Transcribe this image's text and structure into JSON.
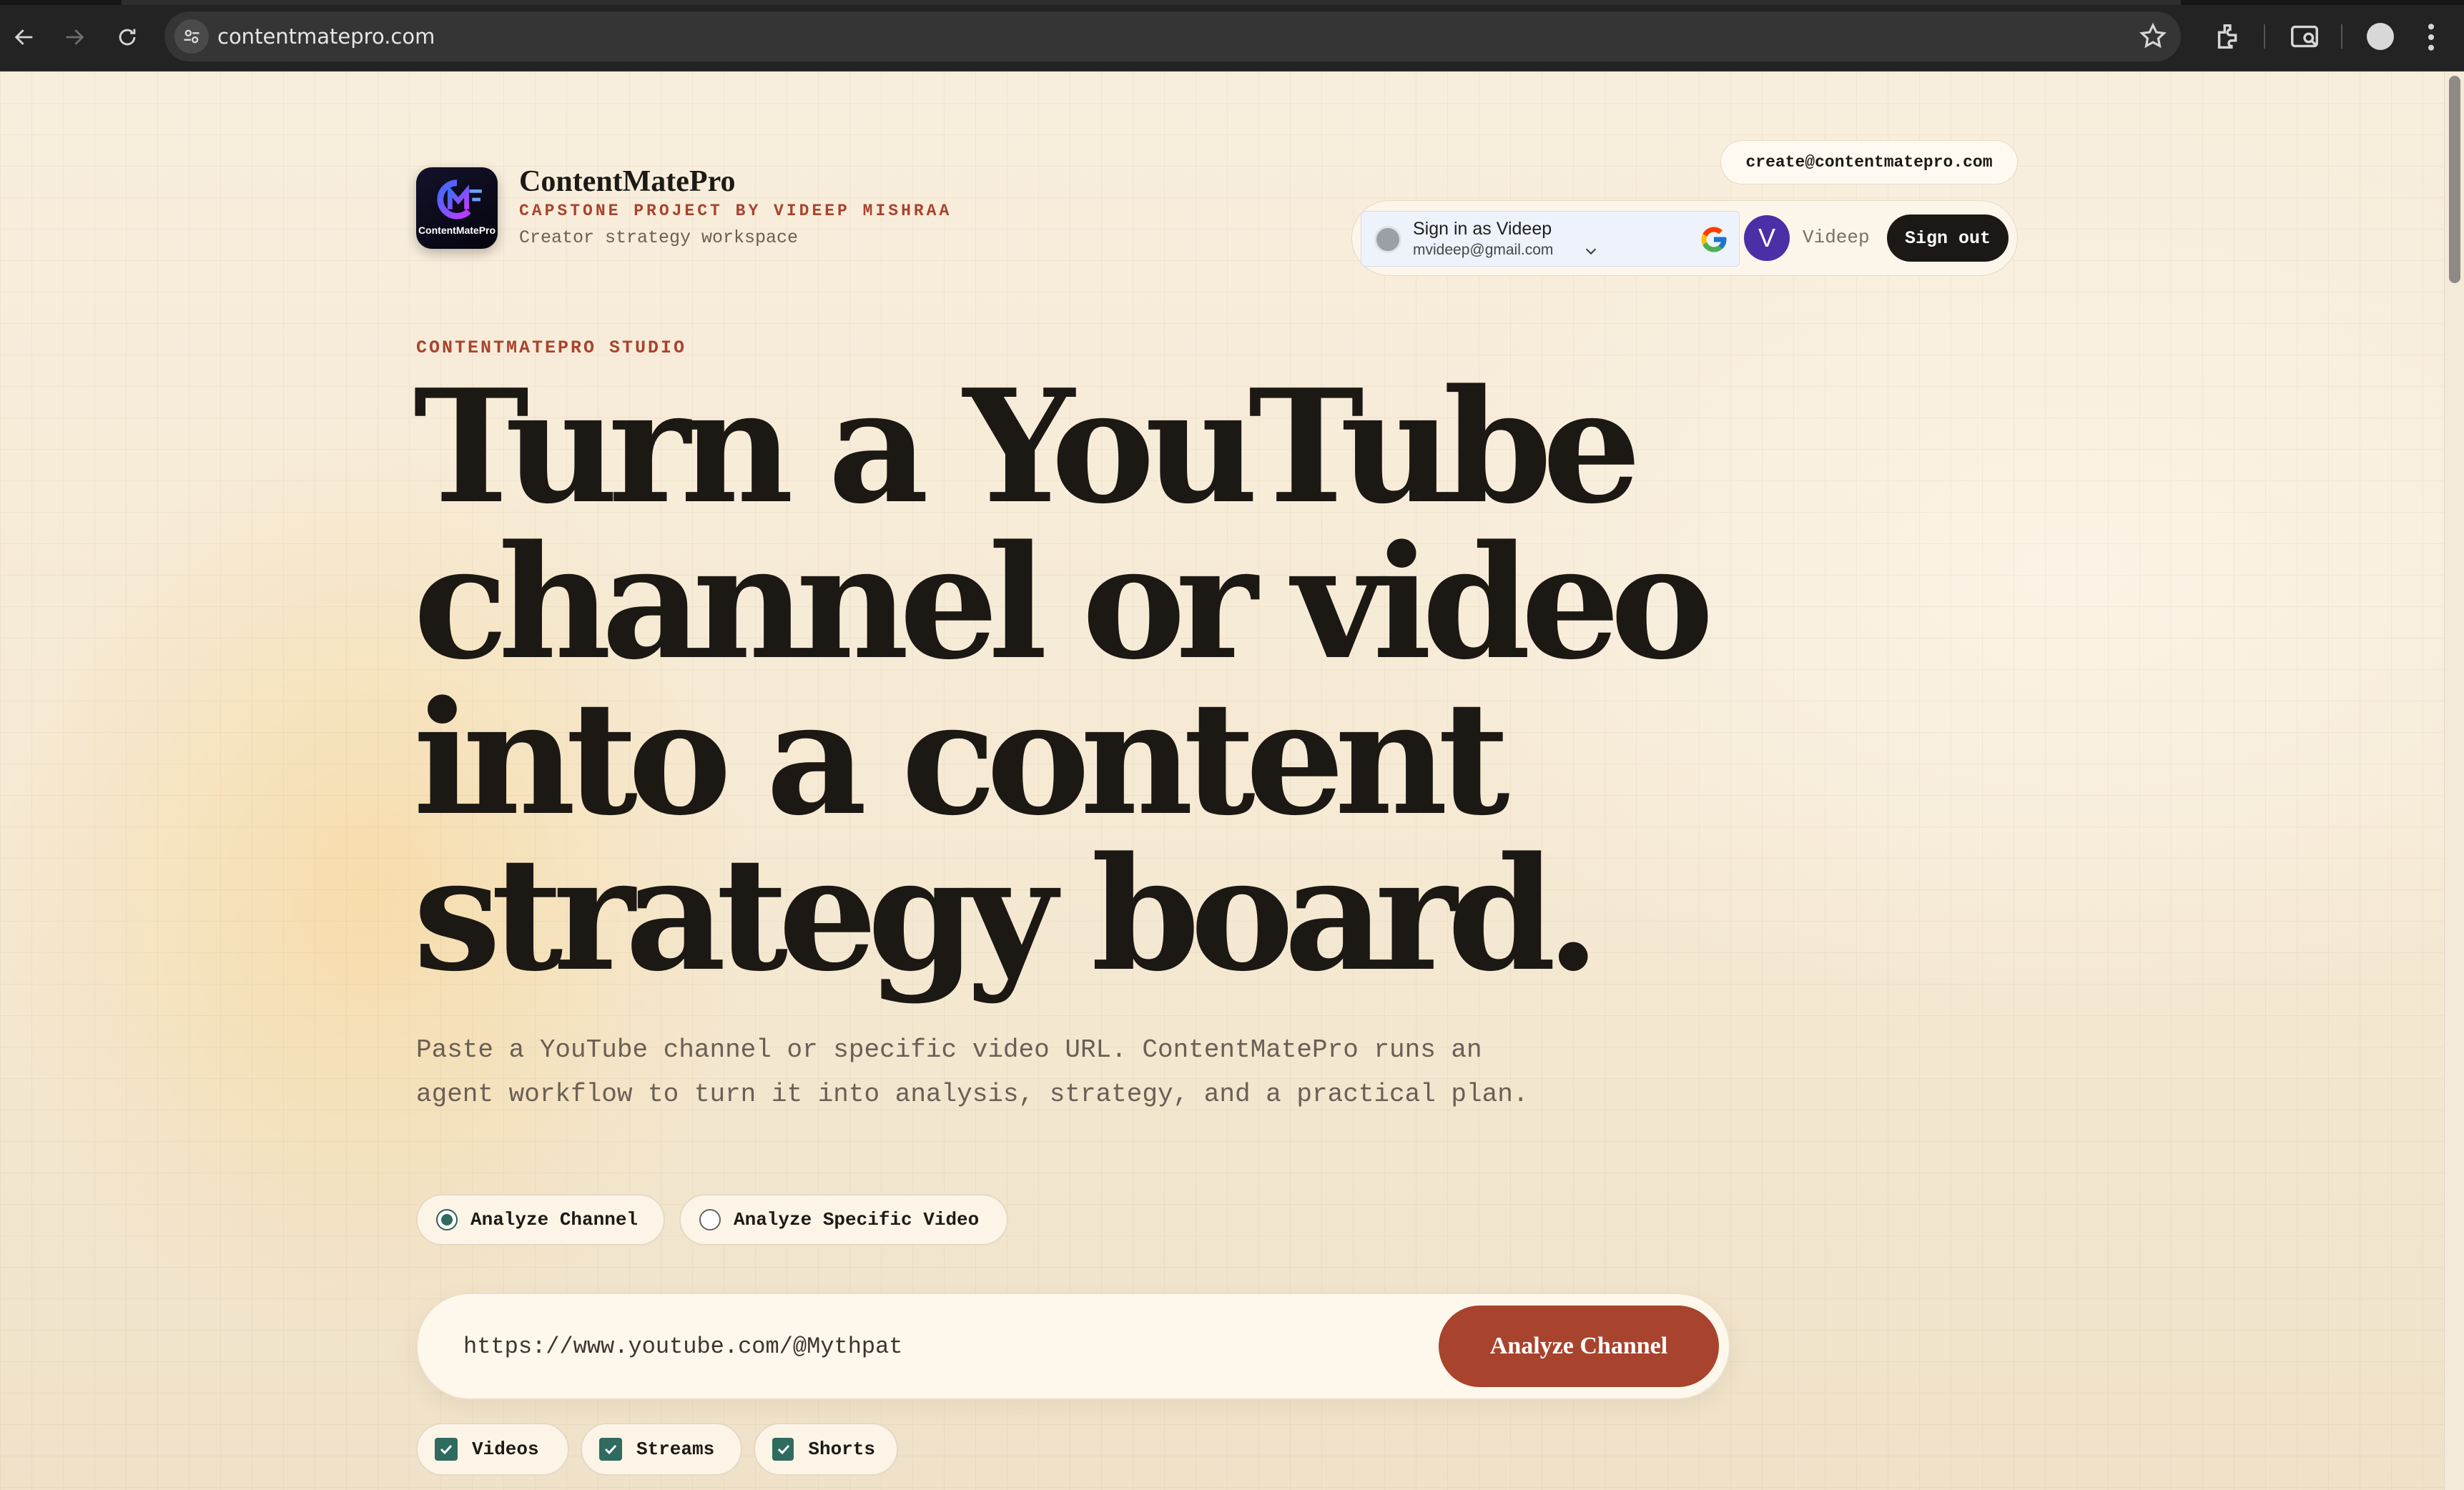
{
  "browser": {
    "url": "contentmatepro.com"
  },
  "brand": {
    "name": "ContentMatePro",
    "logo_text": "ContentMatePro",
    "subtitle": "CAPSTONE PROJECT BY VIDEEP MISHRAA",
    "tagline": "Creator strategy workspace"
  },
  "contact": {
    "email": "create@contentmatepro.com"
  },
  "auth": {
    "google_title": "Sign in as Videep",
    "google_email": "mvideep@gmail.com",
    "avatar_initial": "V",
    "user_name": "Videep",
    "sign_out_label": "Sign out"
  },
  "hero": {
    "eyebrow": "CONTENTMATEPRO STUDIO",
    "headline_lines": [
      "Turn a YouTube",
      "channel or video",
      "into a content",
      "strategy board."
    ],
    "lede": "Paste a YouTube channel or specific video URL. ContentMatePro runs an agent workflow to turn it into analysis, strategy, and a practical plan."
  },
  "modes": [
    {
      "label": "Analyze Channel",
      "selected": true
    },
    {
      "label": "Analyze Specific Video",
      "selected": false
    }
  ],
  "search": {
    "value": "https://www.youtube.com/@Mythpat",
    "button_label": "Analyze Channel"
  },
  "filters": [
    {
      "label": "Videos",
      "checked": true
    },
    {
      "label": "Streams",
      "checked": true
    },
    {
      "label": "Shorts",
      "checked": true
    }
  ],
  "colors": {
    "accent": "#a8432d",
    "check": "#2f6b5f",
    "ink": "#1c1814",
    "avatar": "#4b2fa6"
  }
}
